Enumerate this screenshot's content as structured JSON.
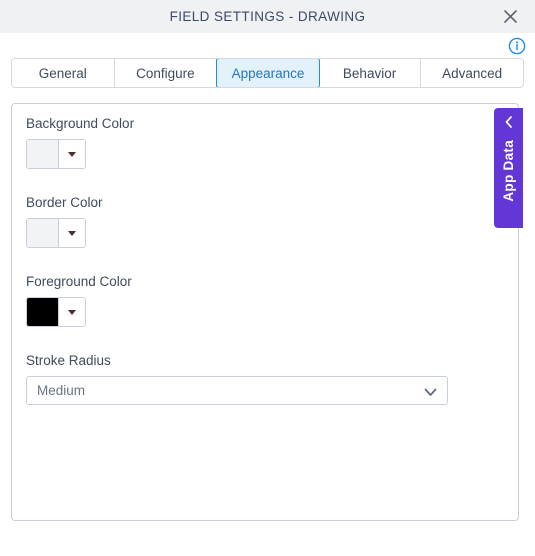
{
  "window": {
    "title": "FIELD SETTINGS - DRAWING",
    "close_icon": "close-icon",
    "info_icon": "info-icon"
  },
  "tabs": [
    {
      "label": "General",
      "active": false
    },
    {
      "label": "Configure",
      "active": false
    },
    {
      "label": "Appearance",
      "active": true
    },
    {
      "label": "Behavior",
      "active": false
    },
    {
      "label": "Advanced",
      "active": false
    }
  ],
  "form": {
    "background_color": {
      "label": "Background Color",
      "swatch_value": "#f2f3f5",
      "dropdown_icon": "caret-down-icon"
    },
    "border_color": {
      "label": "Border Color",
      "swatch_value": "#f2f3f5",
      "dropdown_icon": "caret-down-icon"
    },
    "foreground_color": {
      "label": "Foreground Color",
      "swatch_value": "#000000",
      "dropdown_icon": "caret-down-icon"
    },
    "stroke_radius": {
      "label": "Stroke Radius",
      "value": "Medium",
      "options": [
        "Medium"
      ],
      "chevron_icon": "chevron-down-icon"
    }
  },
  "app_data_tab": {
    "label": "App Data",
    "chevron_icon": "chevron-left-icon",
    "color": "#6536d6"
  },
  "colors": {
    "accent_blue": "#1f8ceb",
    "active_tab_bg": "#e3f1fb",
    "titlebar_bg": "#f0f1f3",
    "border": "#c9cfda",
    "text": "#3f4b5e"
  }
}
